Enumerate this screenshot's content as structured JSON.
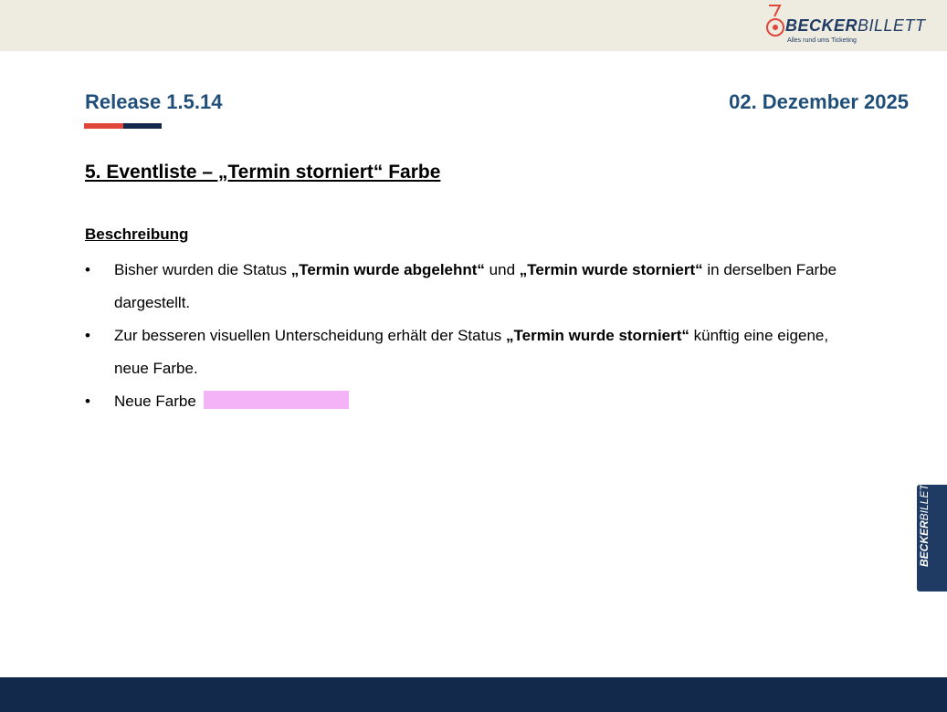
{
  "logo": {
    "brand_bold": "BECKER",
    "brand_light": "BILLETT",
    "tagline": "Alles rund ums Ticketing"
  },
  "header": {
    "release": "Release 1.5.14",
    "date": "02. Dezember 2025"
  },
  "section": {
    "title": "5. Eventliste – „Termin storniert“ Farbe",
    "subheading": "Beschreibung",
    "bullet_1": {
      "pre": "Bisher wurden die Status ",
      "status_a": "„Termin wurde abgelehnt“",
      "mid": " und ",
      "status_b": "„Termin wurde storniert“",
      "post": " in derselben Farbe dargestellt."
    },
    "bullet_2": {
      "pre": "Zur besseren visuellen Unterscheidung erhält der Status ",
      "status": "„Termin wurde storniert“",
      "post": " künftig eine eigene, neue Farbe."
    },
    "bullet_3": {
      "label": "Neue Farbe"
    },
    "bullet_symbol": "•",
    "new_color": "#f5b3f7"
  },
  "side_tab": {
    "brand_bold": "BECKER",
    "brand_light": "BILLETT"
  },
  "colors": {
    "topbar": "#eeebe0",
    "heading_blue": "#1f4e79",
    "accent_red": "#e0463a",
    "navy": "#13294b"
  }
}
